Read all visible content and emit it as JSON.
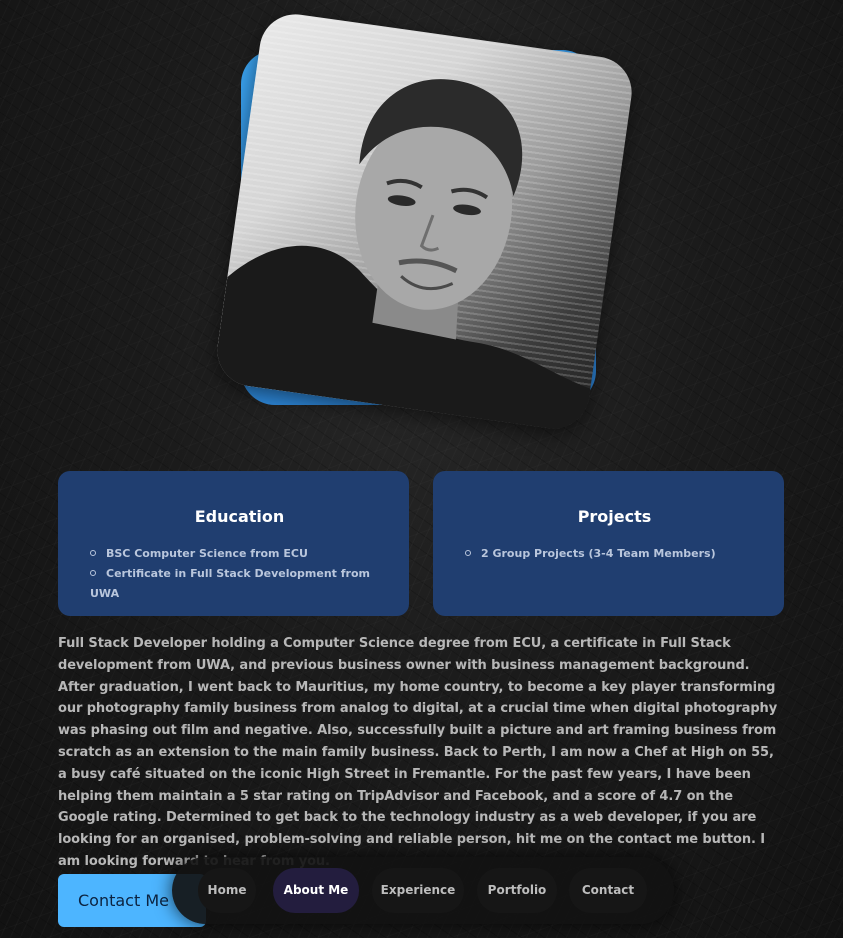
{
  "profile": {
    "photo": "profile-photo"
  },
  "education": {
    "title": "Education",
    "items": [
      "BSC Computer Science from ECU",
      "Certificate in Full Stack Development from UWA"
    ]
  },
  "projects": {
    "title": "Projects",
    "items": [
      "2 Group Projects (3-4 Team Members)"
    ]
  },
  "about_text": "Full Stack Developer holding a Computer Science degree from ECU, a certificate in Full Stack development from UWA, and previous business owner with business management background. After graduation, I went back to Mauritius, my home country, to become a key player transforming our photography family business from analog to digital, at a crucial time when digital photography was phasing out film and negative. Also, successfully built a picture and art framing business from scratch as an extension to the main family business. Back to Perth, I am now a Chef at High on 55, a busy café situated on the iconic High Street in Fremantle. For the past few years, I have been helping them maintain a 5 star rating on TripAdvisor and Facebook, and a score of 4.7 on the Google rating. Determined to get back to the technology industry as a web developer, if you are looking for an organised, problem-solving and reliable person, hit me on the contact me button. I am looking forward to hear from you.",
  "contact_button": "Contact Me",
  "nav": {
    "items": [
      "Home",
      "About Me",
      "Experience",
      "Portfolio",
      "Contact"
    ],
    "active": "About Me"
  },
  "colors": {
    "accent": "#4db5ff",
    "card": "#203e70",
    "nav_active": "#231d3e"
  }
}
